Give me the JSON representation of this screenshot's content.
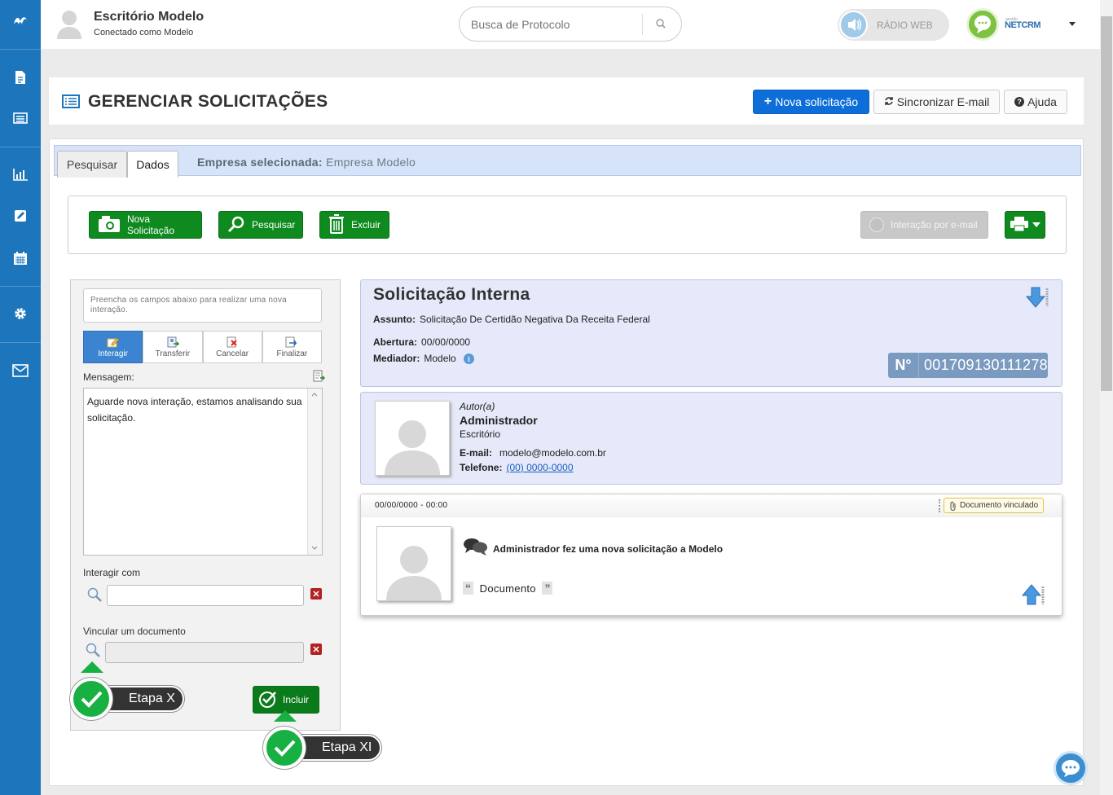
{
  "sidebar": {
    "items": [
      {
        "icon": "logo-icon"
      },
      {
        "icon": "document-icon"
      },
      {
        "icon": "list-icon"
      },
      {
        "icon": "chart-icon"
      },
      {
        "icon": "edit-icon"
      },
      {
        "icon": "calendar-icon"
      },
      {
        "icon": "gear-icon"
      },
      {
        "icon": "mail-icon"
      }
    ],
    "color": "#1d76bc"
  },
  "header": {
    "org_title": "Escritório Modelo",
    "org_subtitle": "Conectado como Modelo",
    "search_placeholder": "Busca de Protocolo",
    "radio_label": "RÁDIO WEB",
    "brand_small": "gestão",
    "brand": "NETCRM"
  },
  "titlebar": {
    "title": "GERENCIAR SOLICITAÇÕES",
    "new_request": "Nova solicitação",
    "sync_email": "Sincronizar E-mail",
    "help": "Ajuda"
  },
  "tabs": {
    "search": "Pesquisar",
    "data": "Dados",
    "company_label": "Empresa selecionada:",
    "company_value": "Empresa Modelo"
  },
  "toolbar": {
    "new": "Nova Solicitação",
    "search": "Pesquisar",
    "delete": "Excluir",
    "email_interaction": "Interação por e-mail"
  },
  "form": {
    "hint": "Preencha os campos abaixo para realizar uma nova interação.",
    "actions": [
      "Interagir",
      "Transferir",
      "Cancelar",
      "Finalizar"
    ],
    "message_label": "Mensagem:",
    "message_text": "Aguarde nova interação, estamos analisando sua solicitação.",
    "interact_with_label": "Interagir com",
    "interact_with_value": "",
    "link_doc_label": "Vincular um documento",
    "link_doc_value": "",
    "include_button": "Incluir"
  },
  "callouts": {
    "step_x": "Etapa X",
    "step_xi": "Etapa XI"
  },
  "request": {
    "title": "Solicitação Interna",
    "subject_label": "Assunto:",
    "subject_value": "Solicitação De Certidão Negativa Da Receita Federal",
    "opened_label": "Abertura:",
    "opened_value": "00/00/0000",
    "mediator_label": "Mediador:",
    "mediator_value": "Modelo",
    "protocol_label": "N°",
    "protocol_number": "001709130111278"
  },
  "author": {
    "role": "Autor(a)",
    "name": "Administrador",
    "org": "Escritório",
    "email_label": "E-mail:",
    "email_value": "modelo@modelo.com.br",
    "phone_label": "Telefone:",
    "phone_value": "(00) 0000-0000"
  },
  "interaction": {
    "datetime": "00/00/0000 - 00:00",
    "doc_badge": "Documento vinculado",
    "text": "Administrador fez uma nova solicitação a Modelo",
    "doc_name": "Documento"
  }
}
